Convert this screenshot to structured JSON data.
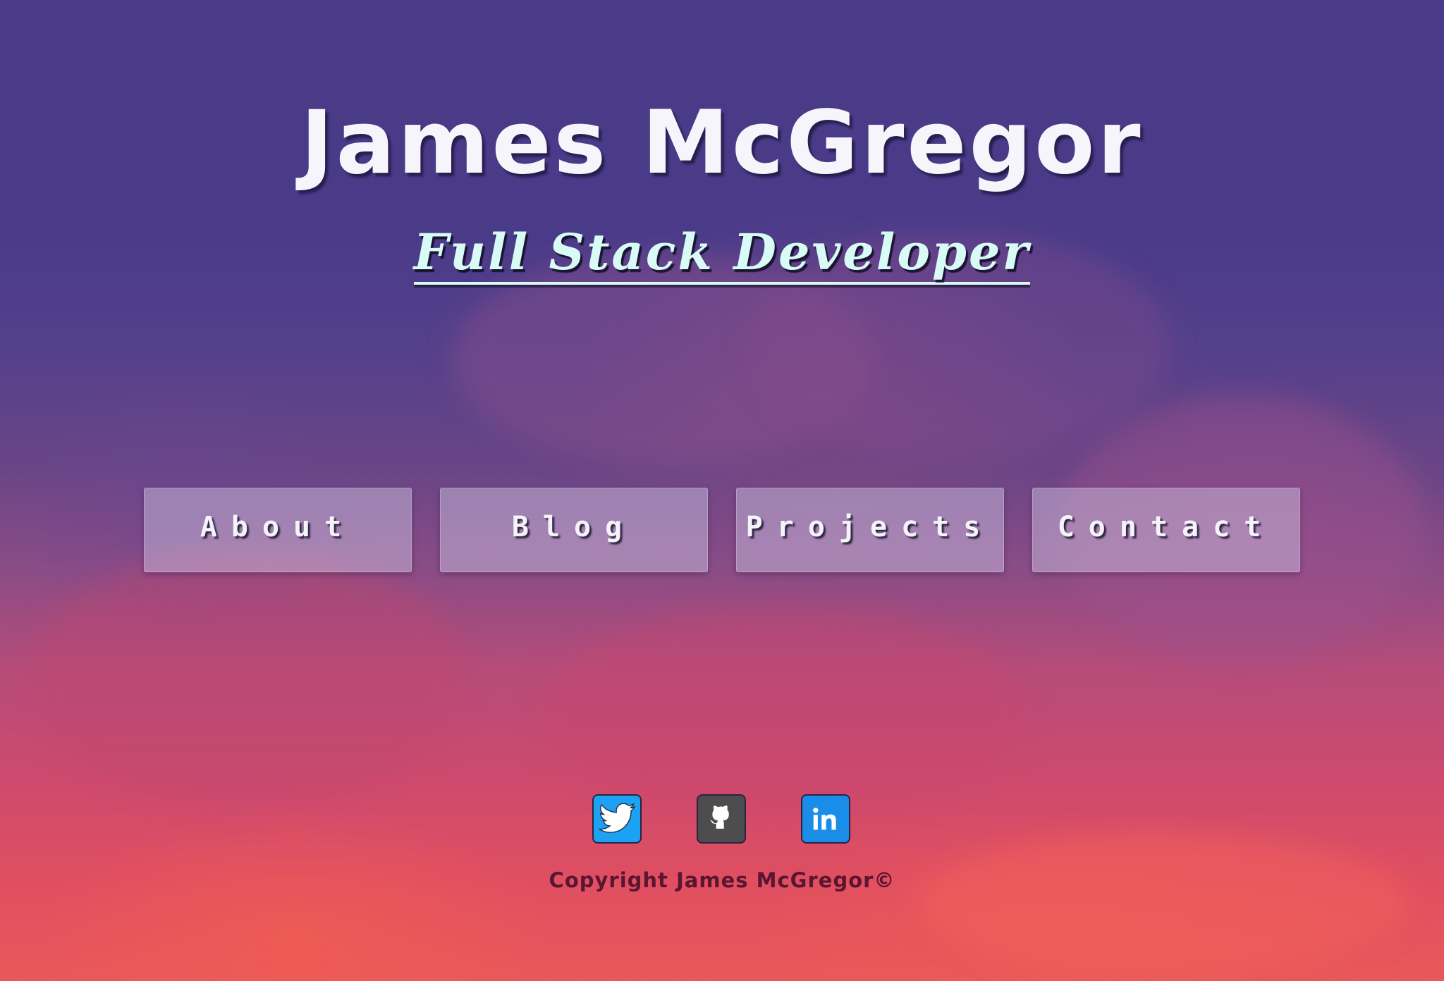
{
  "header": {
    "name": "James McGregor",
    "tagline": "Full Stack Developer"
  },
  "nav": {
    "items": [
      {
        "label": "About"
      },
      {
        "label": "Blog"
      },
      {
        "label": "Projects"
      },
      {
        "label": "Contact"
      }
    ]
  },
  "social": {
    "items": [
      {
        "icon": "twitter-icon",
        "color": "#1da1f2"
      },
      {
        "icon": "github-icon",
        "color": "#4d4d4f"
      },
      {
        "icon": "linkedin-icon",
        "color": "#1a8de8"
      }
    ]
  },
  "footer": {
    "copyright": "Copyright James McGregor©"
  },
  "colors": {
    "sky_top": "#4a3b89",
    "sky_bottom": "#e9585a",
    "title": "#f6f5fb",
    "tagline": "#d8fbf6",
    "footer_text": "#5a1530"
  }
}
